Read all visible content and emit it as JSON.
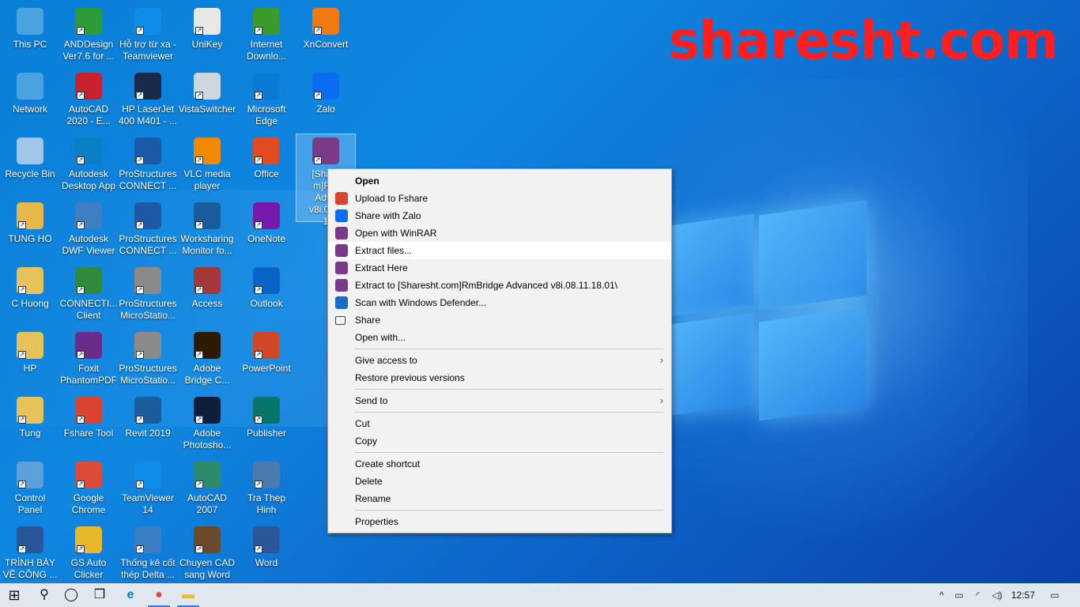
{
  "watermark": "sharesht.com",
  "desktop": {
    "columns": [
      [
        {
          "label": "This PC",
          "icon": "monitor-icon",
          "color": "#4aa3df"
        },
        {
          "label": "Network",
          "icon": "network-icon",
          "color": "#4aa3df"
        },
        {
          "label": "Recycle Bin",
          "icon": "recycle-bin-icon",
          "color": "#9fc7e8"
        },
        {
          "label": "TUNG HO",
          "icon": "user-folder-icon",
          "color": "#e6b84a"
        },
        {
          "label": "C Huong",
          "icon": "folder-icon",
          "color": "#e6c35a"
        },
        {
          "label": "HP",
          "icon": "folder-icon",
          "color": "#e6c35a"
        },
        {
          "label": "Tung",
          "icon": "folder-icon",
          "color": "#e6c35a"
        },
        {
          "label": "Control\nPanel",
          "icon": "control-panel-icon",
          "color": "#5ba0d8"
        },
        {
          "label": "TRÌNH BÀY\nVẼ CÔNG ...",
          "icon": "word-doc-icon",
          "color": "#2b579a"
        }
      ],
      [
        {
          "label": "ANDDesign\nVer7.6 for ...",
          "icon": "anddesign-icon",
          "color": "#2e9b3a"
        },
        {
          "label": "AutoCAD\n2020 - E...",
          "icon": "autocad-icon",
          "color": "#c8202f"
        },
        {
          "label": "Autodesk\nDesktop App",
          "icon": "autodesk-icon",
          "color": "#0a80c4"
        },
        {
          "label": "Autodesk\nDWF Viewer",
          "icon": "dwf-viewer-icon",
          "color": "#3d7fc0"
        },
        {
          "label": "CONNECTI...\nClient",
          "icon": "connection-client-icon",
          "color": "#2f8a3c"
        },
        {
          "label": "Foxit\nPhantomPDF",
          "icon": "foxit-icon",
          "color": "#6a2b8a"
        },
        {
          "label": "Fshare Tool",
          "icon": "fshare-icon",
          "color": "#d8442f"
        },
        {
          "label": "Google\nChrome",
          "icon": "chrome-icon",
          "color": "#dd4b39"
        },
        {
          "label": "GS Auto\nClicker",
          "icon": "auto-clicker-icon",
          "color": "#e8b82c"
        }
      ],
      [
        {
          "label": "Hỗ trợ từ xa -\nTeamviewer",
          "icon": "teamviewer-icon",
          "color": "#0e8ee9"
        },
        {
          "label": "HP LaserJet\n400 M401 - ...",
          "icon": "printer-icon",
          "color": "#1a2a4a"
        },
        {
          "label": "ProStructures\nCONNECT ...",
          "icon": "prostructures-icon",
          "color": "#1c5aa6"
        },
        {
          "label": "ProStructures\nCONNECT ...",
          "icon": "prostructures-icon",
          "color": "#1c5aa6"
        },
        {
          "label": "ProStructures\nMicroStatio...",
          "icon": "prostructures-icon",
          "color": "#8a8a8a"
        },
        {
          "label": "ProStructures\nMicroStatio...",
          "icon": "prostructures-icon",
          "color": "#8a8a8a"
        },
        {
          "label": "Revit 2019",
          "icon": "revit-icon",
          "color": "#1b5c9a"
        },
        {
          "label": "TeamViewer\n14",
          "icon": "teamviewer-icon",
          "color": "#0e8ee9"
        },
        {
          "label": "Thống kê cốt\nthép Delta ...",
          "icon": "delta-icon",
          "color": "#3a7fc4"
        }
      ],
      [
        {
          "label": "UniKey",
          "icon": "unikey-icon",
          "color": "#e8e8e8"
        },
        {
          "label": "VistaSwitcher",
          "icon": "vistaswitcher-icon",
          "color": "#cfd6de"
        },
        {
          "label": "VLC media\nplayer",
          "icon": "vlc-icon",
          "color": "#f08a00"
        },
        {
          "label": "Worksharing\nMonitor fo...",
          "icon": "revit-icon",
          "color": "#1b5c9a"
        },
        {
          "label": "Access",
          "icon": "access-icon",
          "color": "#a4373a"
        },
        {
          "label": "Adobe\nBridge C...",
          "icon": "bridge-icon",
          "color": "#2d1a00"
        },
        {
          "label": "Adobe\nPhotosho...",
          "icon": "photoshop-icon",
          "color": "#0b1f3a"
        },
        {
          "label": "AutoCAD\n2007",
          "icon": "autocad-icon",
          "color": "#2a8a6a"
        },
        {
          "label": "Chuyen CAD\nsang Word",
          "icon": "cad-to-word-icon",
          "color": "#6b4a2a"
        }
      ],
      [
        {
          "label": "Internet\nDownlo...",
          "icon": "idm-icon",
          "color": "#3a9a2a"
        },
        {
          "label": "Microsoft\nEdge",
          "icon": "edge-icon",
          "color": "#0a7ad4"
        },
        {
          "label": "Office",
          "icon": "office-icon",
          "color": "#e34a1f"
        },
        {
          "label": "OneNote",
          "icon": "onenote-icon",
          "color": "#7719aa"
        },
        {
          "label": "Outlook",
          "icon": "outlook-icon",
          "color": "#0a64c8"
        },
        {
          "label": "PowerPoint",
          "icon": "powerpoint-icon",
          "color": "#d24726"
        },
        {
          "label": "Publisher",
          "icon": "publisher-icon",
          "color": "#077568"
        },
        {
          "label": "Tra Thep\nHinh",
          "icon": "steel-table-icon",
          "color": "#4a7ab0"
        },
        {
          "label": "Word",
          "icon": "word-icon",
          "color": "#2b579a"
        }
      ],
      [
        {
          "label": "XnConvert",
          "icon": "xnconvert-icon",
          "color": "#f07a10"
        },
        {
          "label": "Zalo",
          "icon": "zalo-icon",
          "color": "#0a6cf0"
        },
        {
          "label": "[Share\nm]Rm\nAdva\nv8i.08.1\n1",
          "icon": "winrar-archive-icon",
          "color": "#7a3a8a",
          "selected": true
        }
      ]
    ]
  },
  "context_menu": {
    "items": [
      {
        "label": "Open",
        "bold": true,
        "icon": ""
      },
      {
        "label": "Upload to Fshare",
        "icon": "fshare-icon",
        "color": "#d8442f"
      },
      {
        "label": "Share with Zalo",
        "icon": "zalo-icon",
        "color": "#0a6cf0"
      },
      {
        "label": "Open with WinRAR",
        "icon": "winrar-icon",
        "color": "#7a3a8a"
      },
      {
        "label": "Extract files...",
        "icon": "winrar-icon",
        "color": "#7a3a8a",
        "hot": true
      },
      {
        "label": "Extract Here",
        "icon": "winrar-icon",
        "color": "#7a3a8a"
      },
      {
        "label": "Extract to [Sharesht.com]RmBridge Advanced v8i.08.11.18.01\\",
        "icon": "winrar-icon",
        "color": "#7a3a8a"
      },
      {
        "label": "Scan with Windows Defender...",
        "icon": "defender-icon",
        "color": "#1a6ec8"
      },
      {
        "label": "Share",
        "icon": "share-icon",
        "color": ""
      },
      {
        "label": "Open with...",
        "icon": ""
      },
      {
        "sep": true
      },
      {
        "label": "Give access to",
        "icon": "",
        "submenu": true
      },
      {
        "label": "Restore previous versions",
        "icon": ""
      },
      {
        "sep": true
      },
      {
        "label": "Send to",
        "icon": "",
        "submenu": true
      },
      {
        "sep": true
      },
      {
        "label": "Cut",
        "icon": ""
      },
      {
        "label": "Copy",
        "icon": ""
      },
      {
        "sep": true
      },
      {
        "label": "Create shortcut",
        "icon": ""
      },
      {
        "label": "Delete",
        "icon": ""
      },
      {
        "label": "Rename",
        "icon": ""
      },
      {
        "sep": true
      },
      {
        "label": "Properties",
        "icon": ""
      }
    ],
    "submenu_arrow": "›"
  },
  "taskbar": {
    "start_glyph": "⊞",
    "search_glyph": "⚲",
    "cortana_glyph": "◯",
    "taskview_glyph": "❒",
    "pinned": [
      {
        "name": "edge-taskbar-icon",
        "glyph": "e",
        "color": "#0a7ad4"
      },
      {
        "name": "chrome-taskbar-icon",
        "glyph": "●",
        "color": "#dd4b39"
      },
      {
        "name": "explorer-taskbar-icon",
        "glyph": "▬",
        "color": "#e6b84a"
      }
    ],
    "tray": {
      "chevron": "^",
      "battery": "▭",
      "wifi": "◜",
      "volume": "◁)",
      "clock": "12:57",
      "notification": "▭"
    }
  }
}
